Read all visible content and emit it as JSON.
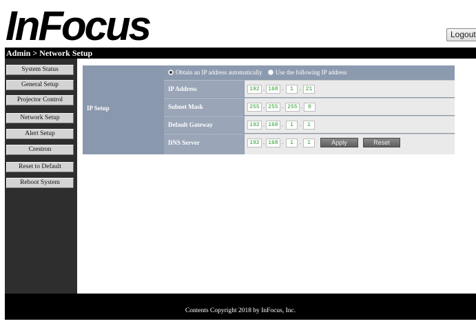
{
  "header": {
    "logo_text": "InFocus",
    "logout_label": "Logout",
    "breadcrumb": "Admin > Network Setup"
  },
  "sidebar": {
    "items": [
      {
        "label": "System Status"
      },
      {
        "label": "General Setup"
      },
      {
        "label": "Projector Control"
      },
      {
        "label": "Network Setup"
      },
      {
        "label": "Alert Setup"
      },
      {
        "label": "Crestron"
      },
      {
        "label": "Reset to Default"
      },
      {
        "label": "Reboot System"
      }
    ]
  },
  "ip_setup": {
    "section_label": "IP Setup",
    "radio_auto_label": "Obtain an IP address automatically",
    "radio_auto_selected": true,
    "radio_manual_label": "Use the following IP address",
    "fields": [
      {
        "label": "IP Address",
        "octets": [
          "192",
          "168",
          "1",
          "21"
        ]
      },
      {
        "label": "Subnet Mask",
        "octets": [
          "255",
          "255",
          "255",
          "0"
        ]
      },
      {
        "label": "Default Gateway",
        "octets": [
          "192",
          "168",
          "1",
          "1"
        ]
      },
      {
        "label": "DNS Server",
        "octets": [
          "192",
          "168",
          "1",
          "1"
        ]
      }
    ],
    "apply_label": "Apply",
    "reset_label": "Reset"
  },
  "footer": {
    "copyright": "Contents Copyright 2018 by InFocus, Inc."
  },
  "colors": {
    "header_bar": "#000000",
    "sidebar_bg": "#2e2e2e",
    "table_header": "#8c9aaf",
    "octet_text": "#2a9a2a"
  }
}
